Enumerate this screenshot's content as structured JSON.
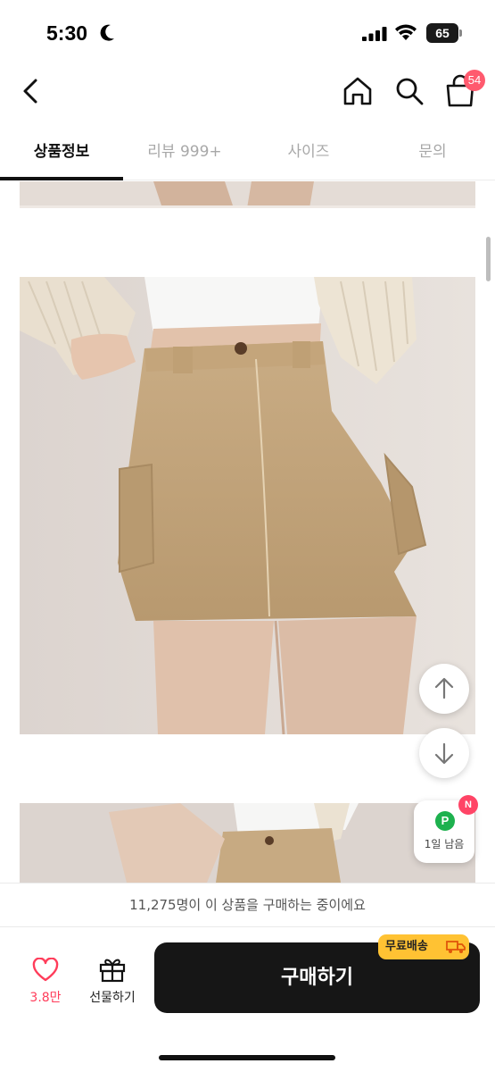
{
  "status_bar": {
    "time": "5:30",
    "battery": "65"
  },
  "header": {
    "back_icon": "chevron-left-icon",
    "home_icon": "home-icon",
    "search_icon": "search-icon",
    "cart_icon": "shopping-bag-icon",
    "cart_count": "54"
  },
  "tabs": [
    {
      "label": "상품정보",
      "active": true
    },
    {
      "label": "리뷰 999+",
      "active": false
    },
    {
      "label": "사이즈",
      "active": false
    },
    {
      "label": "문의",
      "active": false
    }
  ],
  "floating": {
    "scroll_up_icon": "arrow-up-icon",
    "scroll_down_icon": "arrow-down-icon",
    "points_letter": "P",
    "points_label": "1일 남음",
    "points_new_badge": "N"
  },
  "notice": {
    "text": "11,275명이 이 상품을 구매하는 중이에요"
  },
  "bottom_bar": {
    "like_icon": "heart-icon",
    "like_count": "3.8만",
    "gift_icon": "gift-icon",
    "gift_label": "선물하기",
    "buy_label": "구매하기",
    "free_shipping_label": "무료배송",
    "free_shipping_icon": "truck-icon"
  },
  "colors": {
    "accent_pink": "#ff3c5a",
    "buy_button": "#161616",
    "free_shipping_badge": "#ffc233",
    "points_green": "#1db14e"
  }
}
